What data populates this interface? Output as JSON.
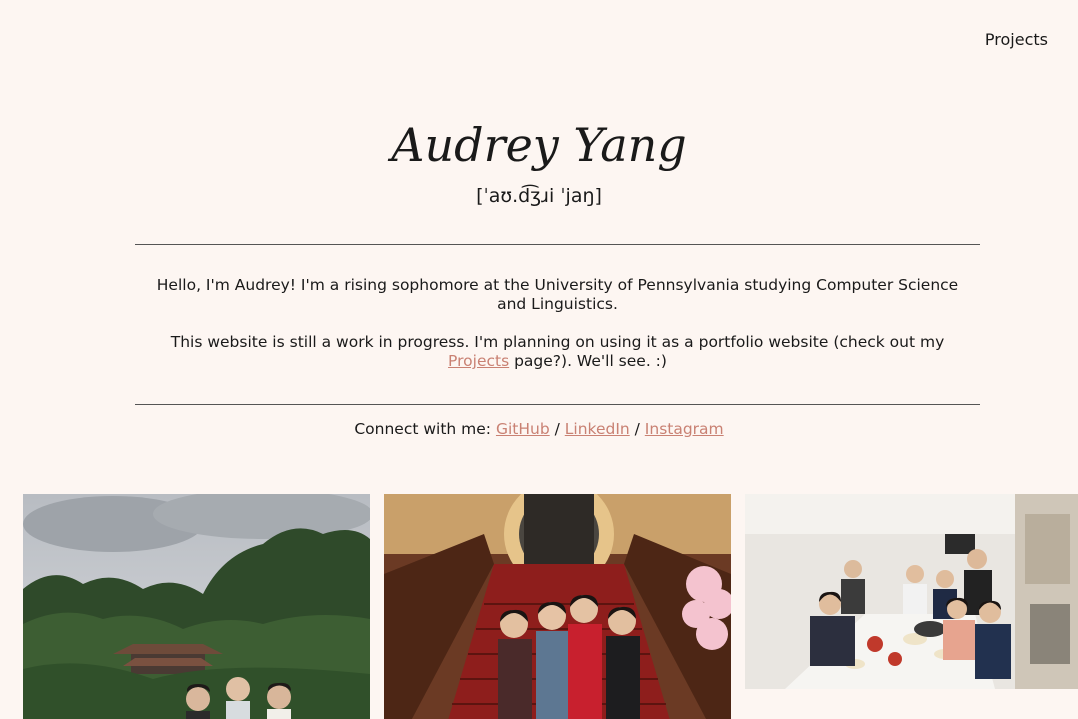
{
  "nav": {
    "projects_label": "Projects"
  },
  "header": {
    "name": "Audrey Yang",
    "pronunciation": "[ˈaʊ.d͡ʒɹi ˈjaŋ]"
  },
  "intro": {
    "paragraph1": "Hello, I'm Audrey! I'm a rising sophomore at the University of Pennsylvania studying Computer Science and Linguistics.",
    "paragraph2_before": "This website is still a work in progress. I'm planning on using it as a portfolio website (check out my ",
    "paragraph2_link": "Projects",
    "paragraph2_after": " page?). We'll see. :)"
  },
  "connect": {
    "prefix": "Connect with me: ",
    "github": "GitHub",
    "sep1": " / ",
    "linkedin": "LinkedIn",
    "sep2": " / ",
    "instagram": "Instagram"
  },
  "photos": [
    {
      "subject": "group-in-garden"
    },
    {
      "subject": "friends-on-red-staircase"
    },
    {
      "subject": "group-dinner-table"
    }
  ],
  "colors": {
    "background": "#fdf6f2",
    "link": "#c98173",
    "text": "#1a1a1a"
  }
}
